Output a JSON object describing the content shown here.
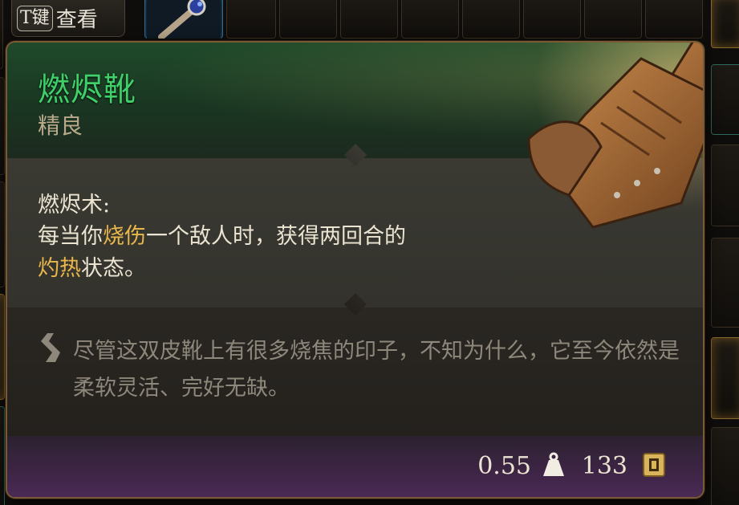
{
  "key_hint": {
    "key": "T键",
    "action": "查看"
  },
  "tooltip": {
    "name": "燃烬靴",
    "rarity": "精良",
    "effect": {
      "title": "燃烬术:",
      "line1_prefix": "每当你",
      "line1_highlight": "烧伤",
      "line1_suffix": "一个敌人时，获得两回合的",
      "line2_highlight": "灼热",
      "line2_suffix": "状态。"
    },
    "flavor": "尽管这双皮靴上有很多烧焦的印子，不知为什么，它至今依然是柔软灵活、完好无缺。",
    "weight": "0.55",
    "price": "133"
  },
  "colors": {
    "name_green": "#3fd06a",
    "highlight_gold": "#e8b64a",
    "border_bronze": "#7a5a34",
    "footer_purple": "#4a2a55"
  },
  "icons": [
    "staff-icon",
    "quote-icon",
    "weight-icon",
    "coin-icon",
    "boots-art"
  ]
}
